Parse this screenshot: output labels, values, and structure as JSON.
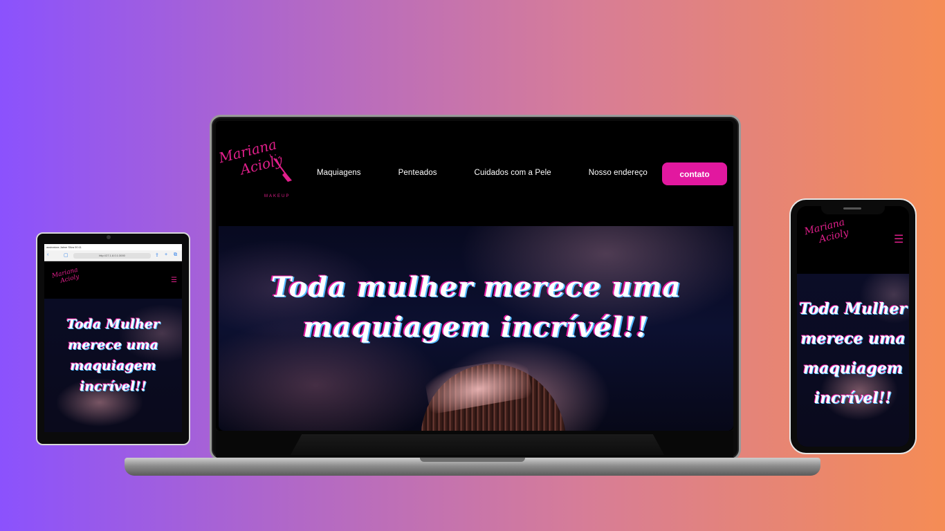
{
  "brand": {
    "logo_line1": "Mariana",
    "logo_line2": "Acioly",
    "logo_sub": "MAKEUP"
  },
  "nav": {
    "items": [
      {
        "label": "Maquiagens"
      },
      {
        "label": "Penteados"
      },
      {
        "label": "Cuidados com a Pele"
      },
      {
        "label": "Nosso endereço"
      }
    ],
    "contact_label": "contato"
  },
  "hero": {
    "title": "Toda mulher merece uma maquiagem incrívél!!"
  },
  "tablet": {
    "status_text": "assinatura Jaime Silva 00:11",
    "url": "http://27.1.8.0.1:3000",
    "hero_title": "Toda Mulher merece uma maquiagem incrível!!",
    "menu_icon": "☰",
    "whatsapp_icon": "✆"
  },
  "phone": {
    "hero_title": "Toda Mulher merece uma maquiagem incrível!!",
    "menu_icon": "☰",
    "whatsapp_icon": "✆"
  },
  "colors": {
    "accent": "#e2189f",
    "whatsapp": "#25a244"
  }
}
